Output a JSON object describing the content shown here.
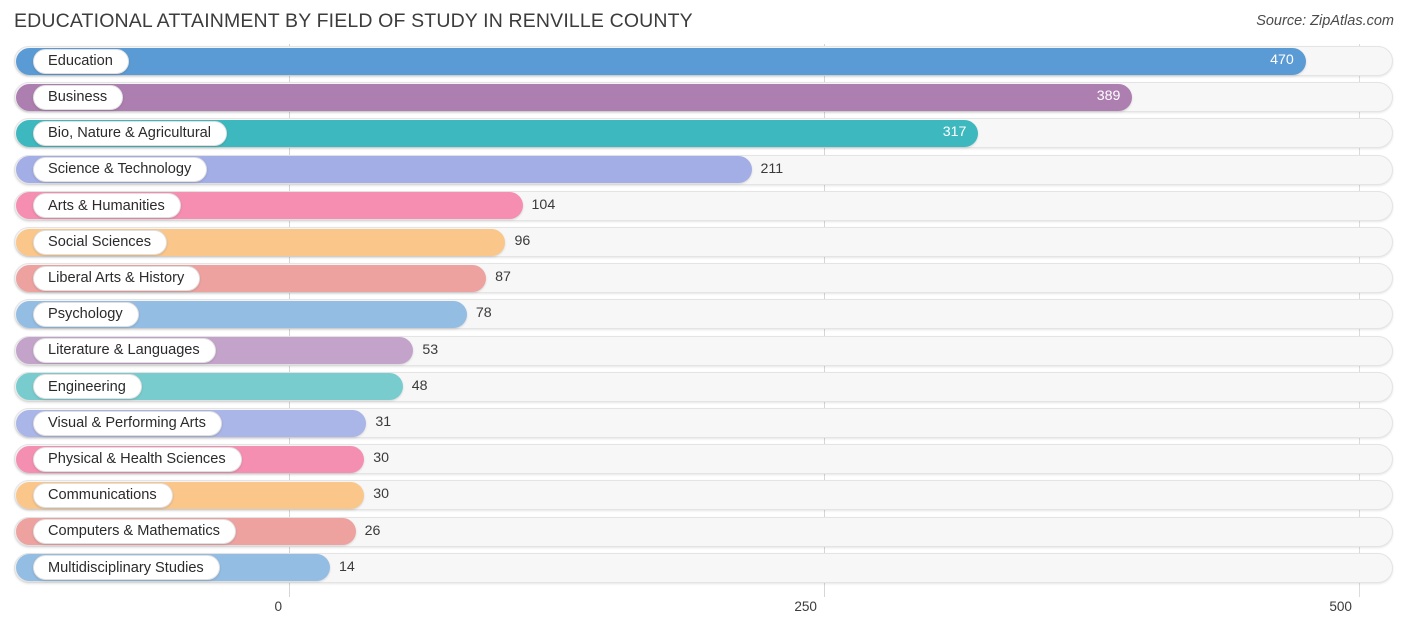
{
  "header": {
    "title": "EDUCATIONAL ATTAINMENT BY FIELD OF STUDY IN RENVILLE COUNTY",
    "source": "Source: ZipAtlas.com"
  },
  "chart_data": {
    "type": "bar",
    "orientation": "horizontal",
    "title": "EDUCATIONAL ATTAINMENT BY FIELD OF STUDY IN RENVILLE COUNTY",
    "subtitle": "",
    "xlabel": "",
    "ylabel": "",
    "xlim": [
      0,
      500
    ],
    "xticks": [
      0,
      250,
      500
    ],
    "xtick_labels": [
      "0",
      "250",
      "500"
    ],
    "grid": true,
    "legend": false,
    "categories": [
      "Education",
      "Business",
      "Bio, Nature & Agricultural",
      "Science & Technology",
      "Arts & Humanities",
      "Social Sciences",
      "Liberal Arts & History",
      "Psychology",
      "Literature & Languages",
      "Engineering",
      "Visual & Performing Arts",
      "Physical & Health Sciences",
      "Communications",
      "Computers & Mathematics",
      "Multidisciplinary Studies"
    ],
    "values": [
      470,
      389,
      317,
      211,
      104,
      96,
      87,
      78,
      53,
      48,
      31,
      30,
      30,
      26,
      14
    ],
    "value_labels": [
      "470",
      "389",
      "317",
      "211",
      "104",
      "96",
      "87",
      "78",
      "53",
      "48",
      "31",
      "30",
      "30",
      "26",
      "14"
    ],
    "colors": [
      "#5b9bd5",
      "#ad7eb0",
      "#3eb8bf",
      "#a3aee6",
      "#f58eb0",
      "#fac68a",
      "#eda2a0",
      "#93bde3",
      "#c3a3ca",
      "#79ccce",
      "#aab5e8",
      "#f58fb1",
      "#fac68a",
      "#eda2a0",
      "#93bde3"
    ],
    "label_inside": [
      true,
      true,
      true,
      false,
      false,
      false,
      false,
      false,
      false,
      false,
      false,
      false,
      false,
      false,
      false
    ]
  },
  "axis": {
    "ticks": [
      "0",
      "250",
      "500"
    ]
  }
}
